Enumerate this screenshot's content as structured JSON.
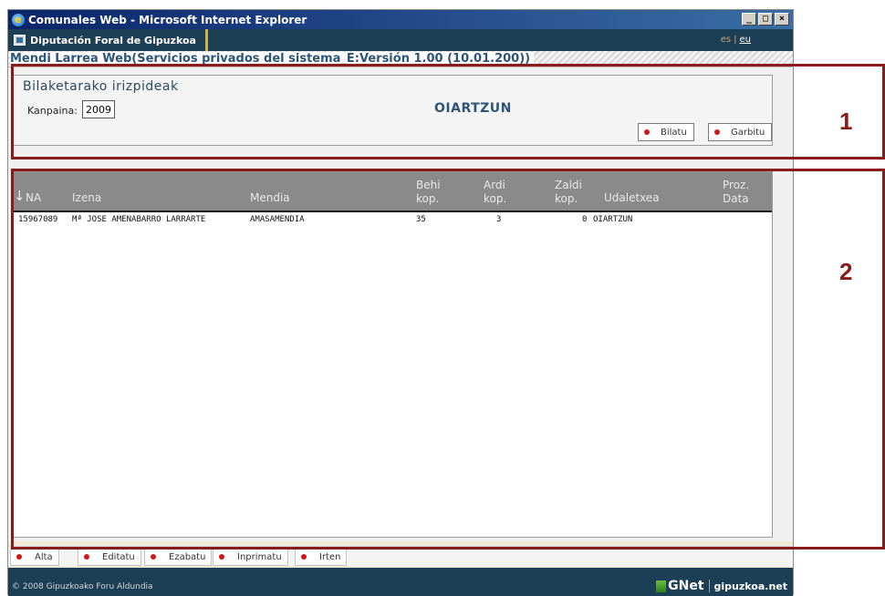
{
  "window": {
    "title": "Comunales Web - Microsoft Internet Explorer",
    "controls": [
      "_",
      "□",
      "×"
    ]
  },
  "header": {
    "brand": "Diputación Foral de Gipuzkoa",
    "lang_es": "es",
    "lang_sep": "|",
    "lang_eu": "eu"
  },
  "subtitle": "Mendi Larrea Web(Servicios privados del sistema_E:Versión 1.00 (10.01.200))",
  "search": {
    "title": "Bilaketarako irizpideak",
    "kanpaina_label": "Kanpaina:",
    "kanpaina_value": "2009",
    "town": "OIARTZUN",
    "search_btn": "Bilatu",
    "clear_btn": "Garbitu"
  },
  "grid": {
    "sort_arrow": "↓",
    "columns": {
      "na": "NA",
      "izena": "Izena",
      "mendia": "Mendia",
      "behi1": "Behi",
      "behi2": "kop.",
      "ardi1": "Ardi",
      "ardi2": "kop.",
      "zaldi1": "Zaldi",
      "zaldi2": "kop.",
      "udaletxea": "Udaletxea",
      "proz1": "Proz.",
      "proz2": "Data"
    },
    "rows": [
      {
        "na": "15967089",
        "izena": "Mª JOSE AMENABARRO LARRARTE",
        "mendia": "AMASAMENDIA",
        "behi": "35",
        "ardi": "3",
        "zaldi": "0",
        "udaletxea": "OIARTZUN",
        "proz_data": ""
      }
    ]
  },
  "toolbar": {
    "alta": "Alta",
    "editatu": "Editatu",
    "ezabatu": "Ezabatu",
    "inprimatu": "Inprimatu",
    "irten": "Irten"
  },
  "footer": {
    "copyright": "© 2008  Gipuzkoako Foru Aldundia",
    "gnet": "GNet",
    "site": "gipuzkoa.net"
  },
  "annotations": {
    "label1": "1",
    "label2": "2"
  },
  "colors": {
    "header_bg": "#1d3f56",
    "accent": "#2c5577",
    "annotation": "#8a1b1b",
    "button_dot": "#d01818"
  }
}
